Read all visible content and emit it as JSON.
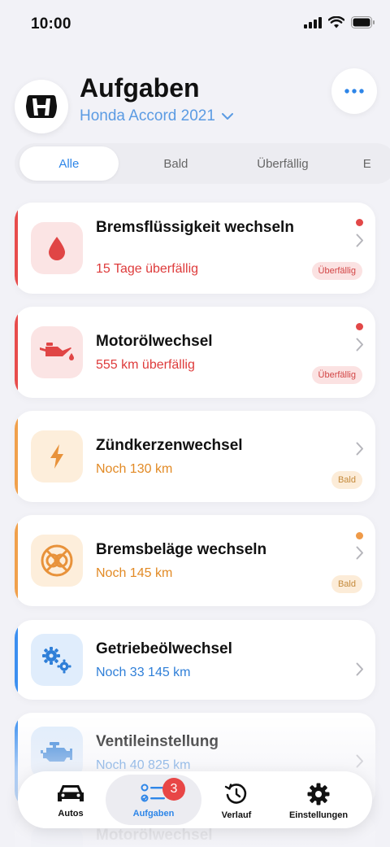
{
  "status_bar": {
    "time": "10:00"
  },
  "header": {
    "title": "Aufgaben",
    "car_name": "Honda Accord 2021",
    "logo_icon": "honda-logo",
    "more_icon": "ellipsis-icon"
  },
  "filter_tabs": [
    {
      "label": "Alle",
      "active": true
    },
    {
      "label": "Bald"
    },
    {
      "label": "Überfällig"
    },
    {
      "label": "E"
    }
  ],
  "tasks": [
    {
      "title": "Bremsflüssigkeit wechseln",
      "subtitle": "15 Tage überfällig",
      "badge": "Überfällig",
      "status": "red",
      "icon": "drop-icon",
      "dot": true
    },
    {
      "title": "Motorölwechsel",
      "subtitle": "555 km überfällig",
      "badge": "Überfällig",
      "status": "red",
      "icon": "oil-can-icon",
      "dot": true
    },
    {
      "title": "Zündkerzenwechsel",
      "subtitle": "Noch 130 km",
      "badge": "Bald",
      "status": "orange",
      "icon": "bolt-icon",
      "dot": false
    },
    {
      "title": "Bremsbeläge wechseln",
      "subtitle": "Noch 145 km",
      "badge": "Bald",
      "status": "orange",
      "icon": "brake-disc-icon",
      "dot": true
    },
    {
      "title": "Getriebeölwechsel",
      "subtitle": "Noch 33 145 km",
      "badge": "",
      "status": "blue",
      "icon": "gears-icon",
      "dot": false
    },
    {
      "title": "Ventileinstellung",
      "subtitle": "Noch 40 825 km",
      "badge": "",
      "status": "blue",
      "icon": "engine-icon",
      "dot": false
    },
    {
      "title": "Motorölwechsel",
      "subtitle": "",
      "badge": "",
      "status": "blue",
      "icon": "oil-can-icon",
      "dot": false
    }
  ],
  "tab_bar": {
    "autos": "Autos",
    "aufgaben": "Aufgaben",
    "aufgaben_badge": "3",
    "verlauf": "Verlauf",
    "einstellungen": "Einstellungen"
  },
  "colors": {
    "accent_blue": "#2e86e8",
    "overdue_red": "#e74c4c",
    "soon_orange": "#f0a04b",
    "later_blue": "#3b8ff0"
  }
}
